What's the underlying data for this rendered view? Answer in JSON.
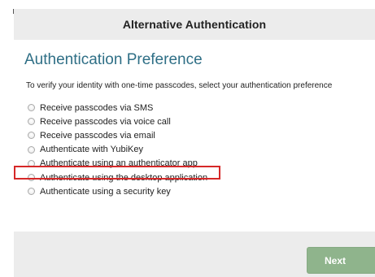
{
  "dialog": {
    "title": "Alternative Authentication",
    "section_title": "Authentication Preference",
    "instructions": "To verify your identity with one-time passcodes, select your authentication preference"
  },
  "options": [
    {
      "label": "Receive passcodes via SMS",
      "selected": false
    },
    {
      "label": "Receive passcodes via voice call",
      "selected": false
    },
    {
      "label": "Receive passcodes via email",
      "selected": false
    },
    {
      "label": "Authenticate with YubiKey",
      "selected": false
    },
    {
      "label": "Authenticate using an authenticator app",
      "selected": false,
      "highlighted": true
    },
    {
      "label": "Authenticate using the desktop application",
      "selected": false
    },
    {
      "label": "Authenticate using a security key",
      "selected": false
    }
  ],
  "footer": {
    "next_label": "Next"
  },
  "colors": {
    "header_bg": "#ececec",
    "section_title": "#2f6f86",
    "highlight": "#d62828",
    "next_button": "#8fb48c"
  }
}
